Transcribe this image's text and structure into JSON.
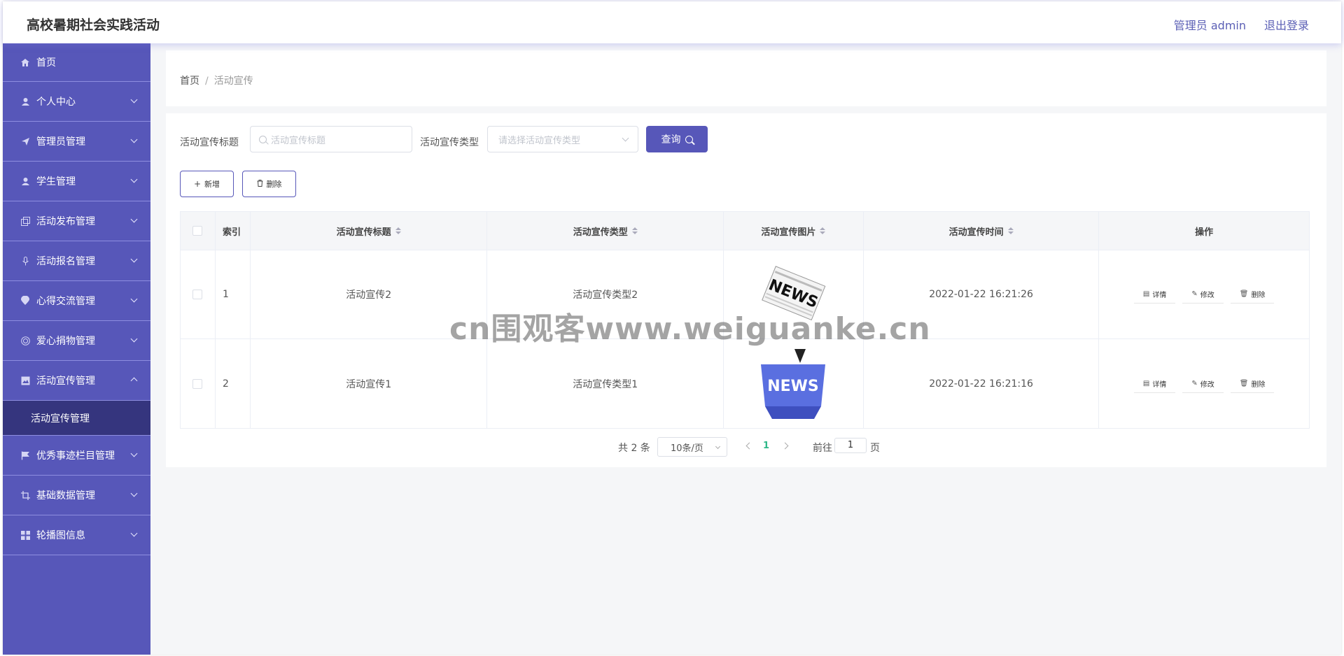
{
  "header": {
    "title": "高校暑期社会实践活动",
    "user": "管理员 admin",
    "logout": "退出登录"
  },
  "sidebar": {
    "items": [
      {
        "label": "首页",
        "icon": "home-icon"
      },
      {
        "label": "个人中心",
        "icon": "user-icon"
      },
      {
        "label": "管理员管理",
        "icon": "send-icon"
      },
      {
        "label": "学生管理",
        "icon": "user-icon"
      },
      {
        "label": "活动发布管理",
        "icon": "copy-icon"
      },
      {
        "label": "活动报名管理",
        "icon": "mic-icon"
      },
      {
        "label": "心得交流管理",
        "icon": "location-icon"
      },
      {
        "label": "爱心捐物管理",
        "icon": "target-icon"
      },
      {
        "label": "活动宣传管理",
        "icon": "picture-icon"
      },
      {
        "label": "活动宣传管理"
      },
      {
        "label": "优秀事迹栏目管理",
        "icon": "flag-icon"
      },
      {
        "label": "基础数据管理",
        "icon": "crop-icon"
      },
      {
        "label": "轮播图信息",
        "icon": "grid-icon"
      }
    ]
  },
  "breadcrumb": {
    "home": "首页",
    "sep": "/",
    "current": "活动宣传"
  },
  "search": {
    "title_label": "活动宣传标题",
    "title_placeholder": "活动宣传标题",
    "type_label": "活动宣传类型",
    "type_placeholder": "请选择活动宣传类型",
    "query": "查询"
  },
  "actions": {
    "add": "新增",
    "delete": "删除"
  },
  "table": {
    "headers": [
      "索引",
      "活动宣传标题",
      "活动宣传类型",
      "活动宣传图片",
      "活动宣传时间",
      "操作"
    ],
    "rows": [
      {
        "index": "1",
        "title": "活动宣传2",
        "type": "活动宣传类型2",
        "image": "NEWS",
        "time": "2022-01-22 16:21:26"
      },
      {
        "index": "2",
        "title": "活动宣传1",
        "type": "活动宣传类型1",
        "image": "NEWS",
        "time": "2022-01-22 16:21:16"
      }
    ],
    "ops": {
      "detail": "详情",
      "edit": "修改",
      "delete": "删除"
    }
  },
  "pager": {
    "total": "共 2 条",
    "size": "10条/页",
    "page": "1",
    "goto": "前往",
    "page_input": "1",
    "unit": "页"
  },
  "watermark": "cn围观客www.weiguanke.cn",
  "colors": {
    "accent": "#5757b9",
    "submenu": "#35357e",
    "active_page": "#2fb889"
  }
}
